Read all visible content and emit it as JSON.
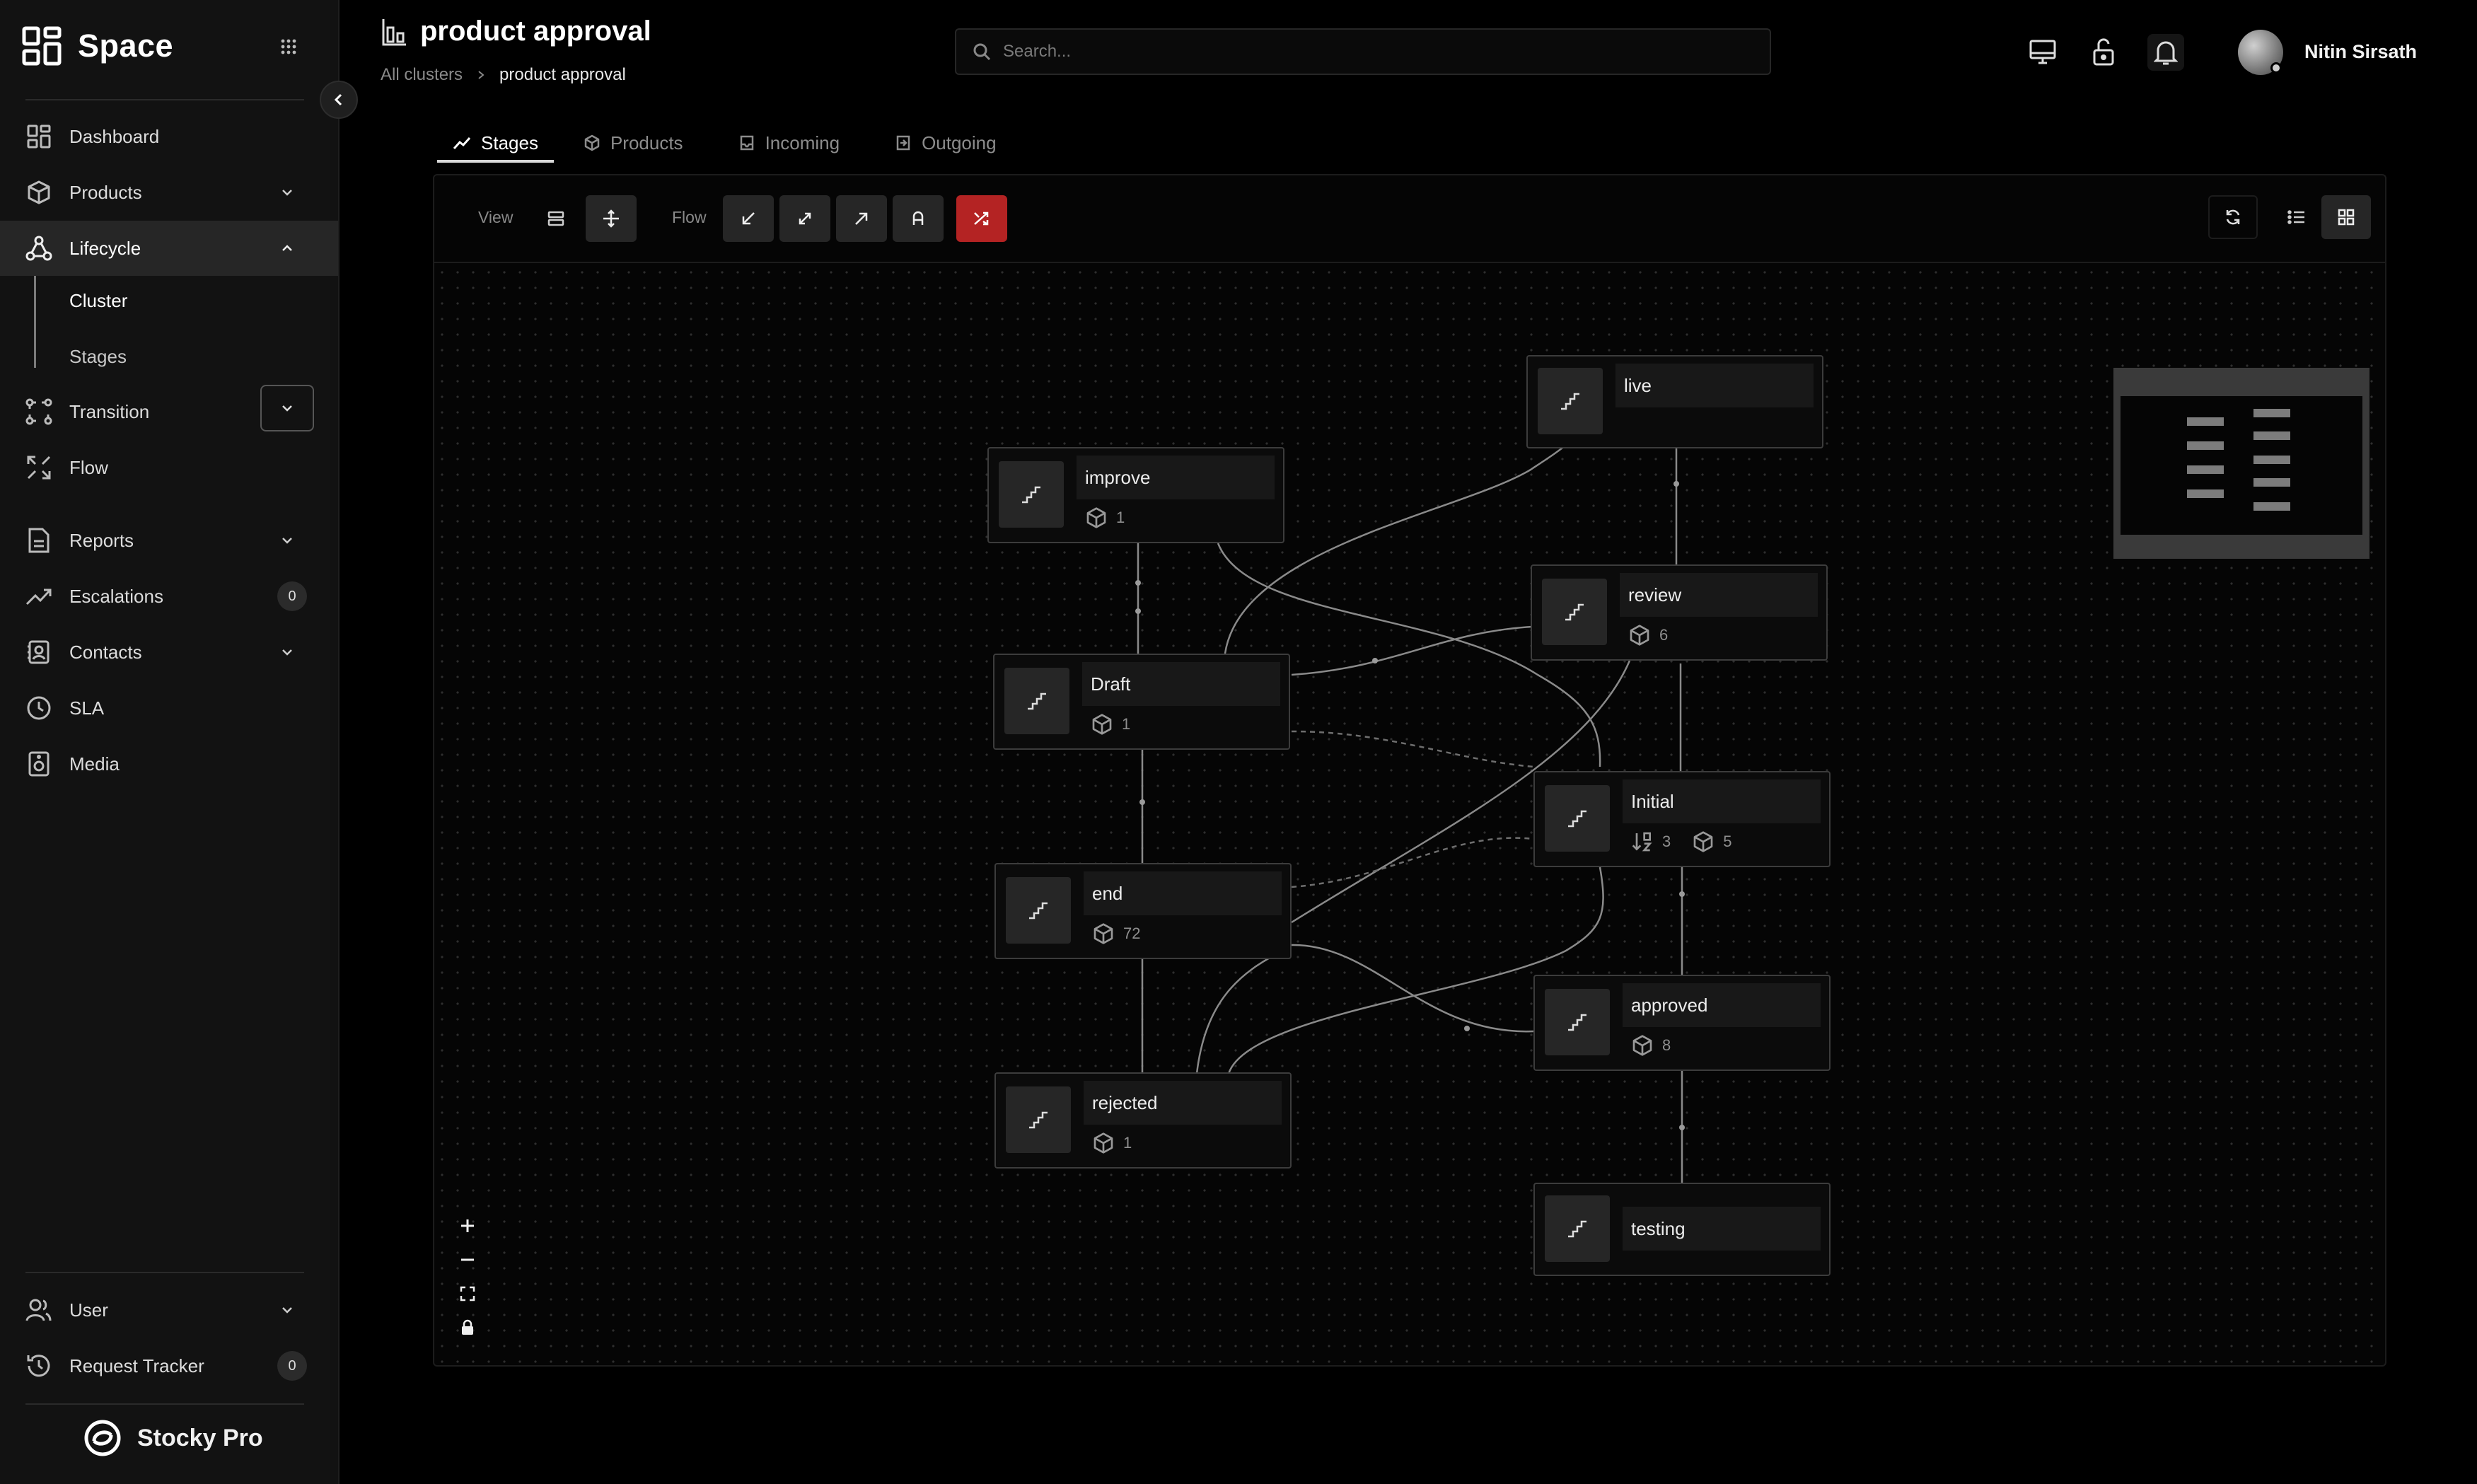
{
  "app": {
    "name": "Space",
    "footer_brand": "Stocky Pro"
  },
  "sidebar": {
    "items": [
      {
        "label": "Dashboard"
      },
      {
        "label": "Products"
      },
      {
        "label": "Lifecycle"
      },
      {
        "label": "Transition"
      },
      {
        "label": "Flow"
      },
      {
        "label": "Reports"
      },
      {
        "label": "Escalations",
        "badge": "0"
      },
      {
        "label": "Contacts"
      },
      {
        "label": "SLA"
      },
      {
        "label": "Media"
      },
      {
        "label": "User"
      },
      {
        "label": "Request Tracker",
        "badge": "0"
      }
    ],
    "lifecycle_sub": [
      {
        "label": "Cluster"
      },
      {
        "label": "Stages"
      }
    ]
  },
  "header": {
    "title": "product approval",
    "breadcrumb": [
      "All clusters",
      "product approval"
    ],
    "search_placeholder": "Search...",
    "user_name": "Nitin Sirsath"
  },
  "tabs": [
    {
      "label": "Stages"
    },
    {
      "label": "Products"
    },
    {
      "label": "Incoming"
    },
    {
      "label": "Outgoing"
    }
  ],
  "toolbar": {
    "view_label": "View",
    "flow_label": "Flow",
    "accent": "#b42323"
  },
  "nodes": [
    {
      "name": "live"
    },
    {
      "name": "improve",
      "products": "1"
    },
    {
      "name": "review",
      "products": "6"
    },
    {
      "name": "Draft",
      "products": "1"
    },
    {
      "name": "Initial",
      "transitions": "3",
      "products": "5"
    },
    {
      "name": "end",
      "products": "72"
    },
    {
      "name": "approved",
      "products": "8"
    },
    {
      "name": "rejected",
      "products": "1"
    },
    {
      "name": "testing"
    }
  ]
}
